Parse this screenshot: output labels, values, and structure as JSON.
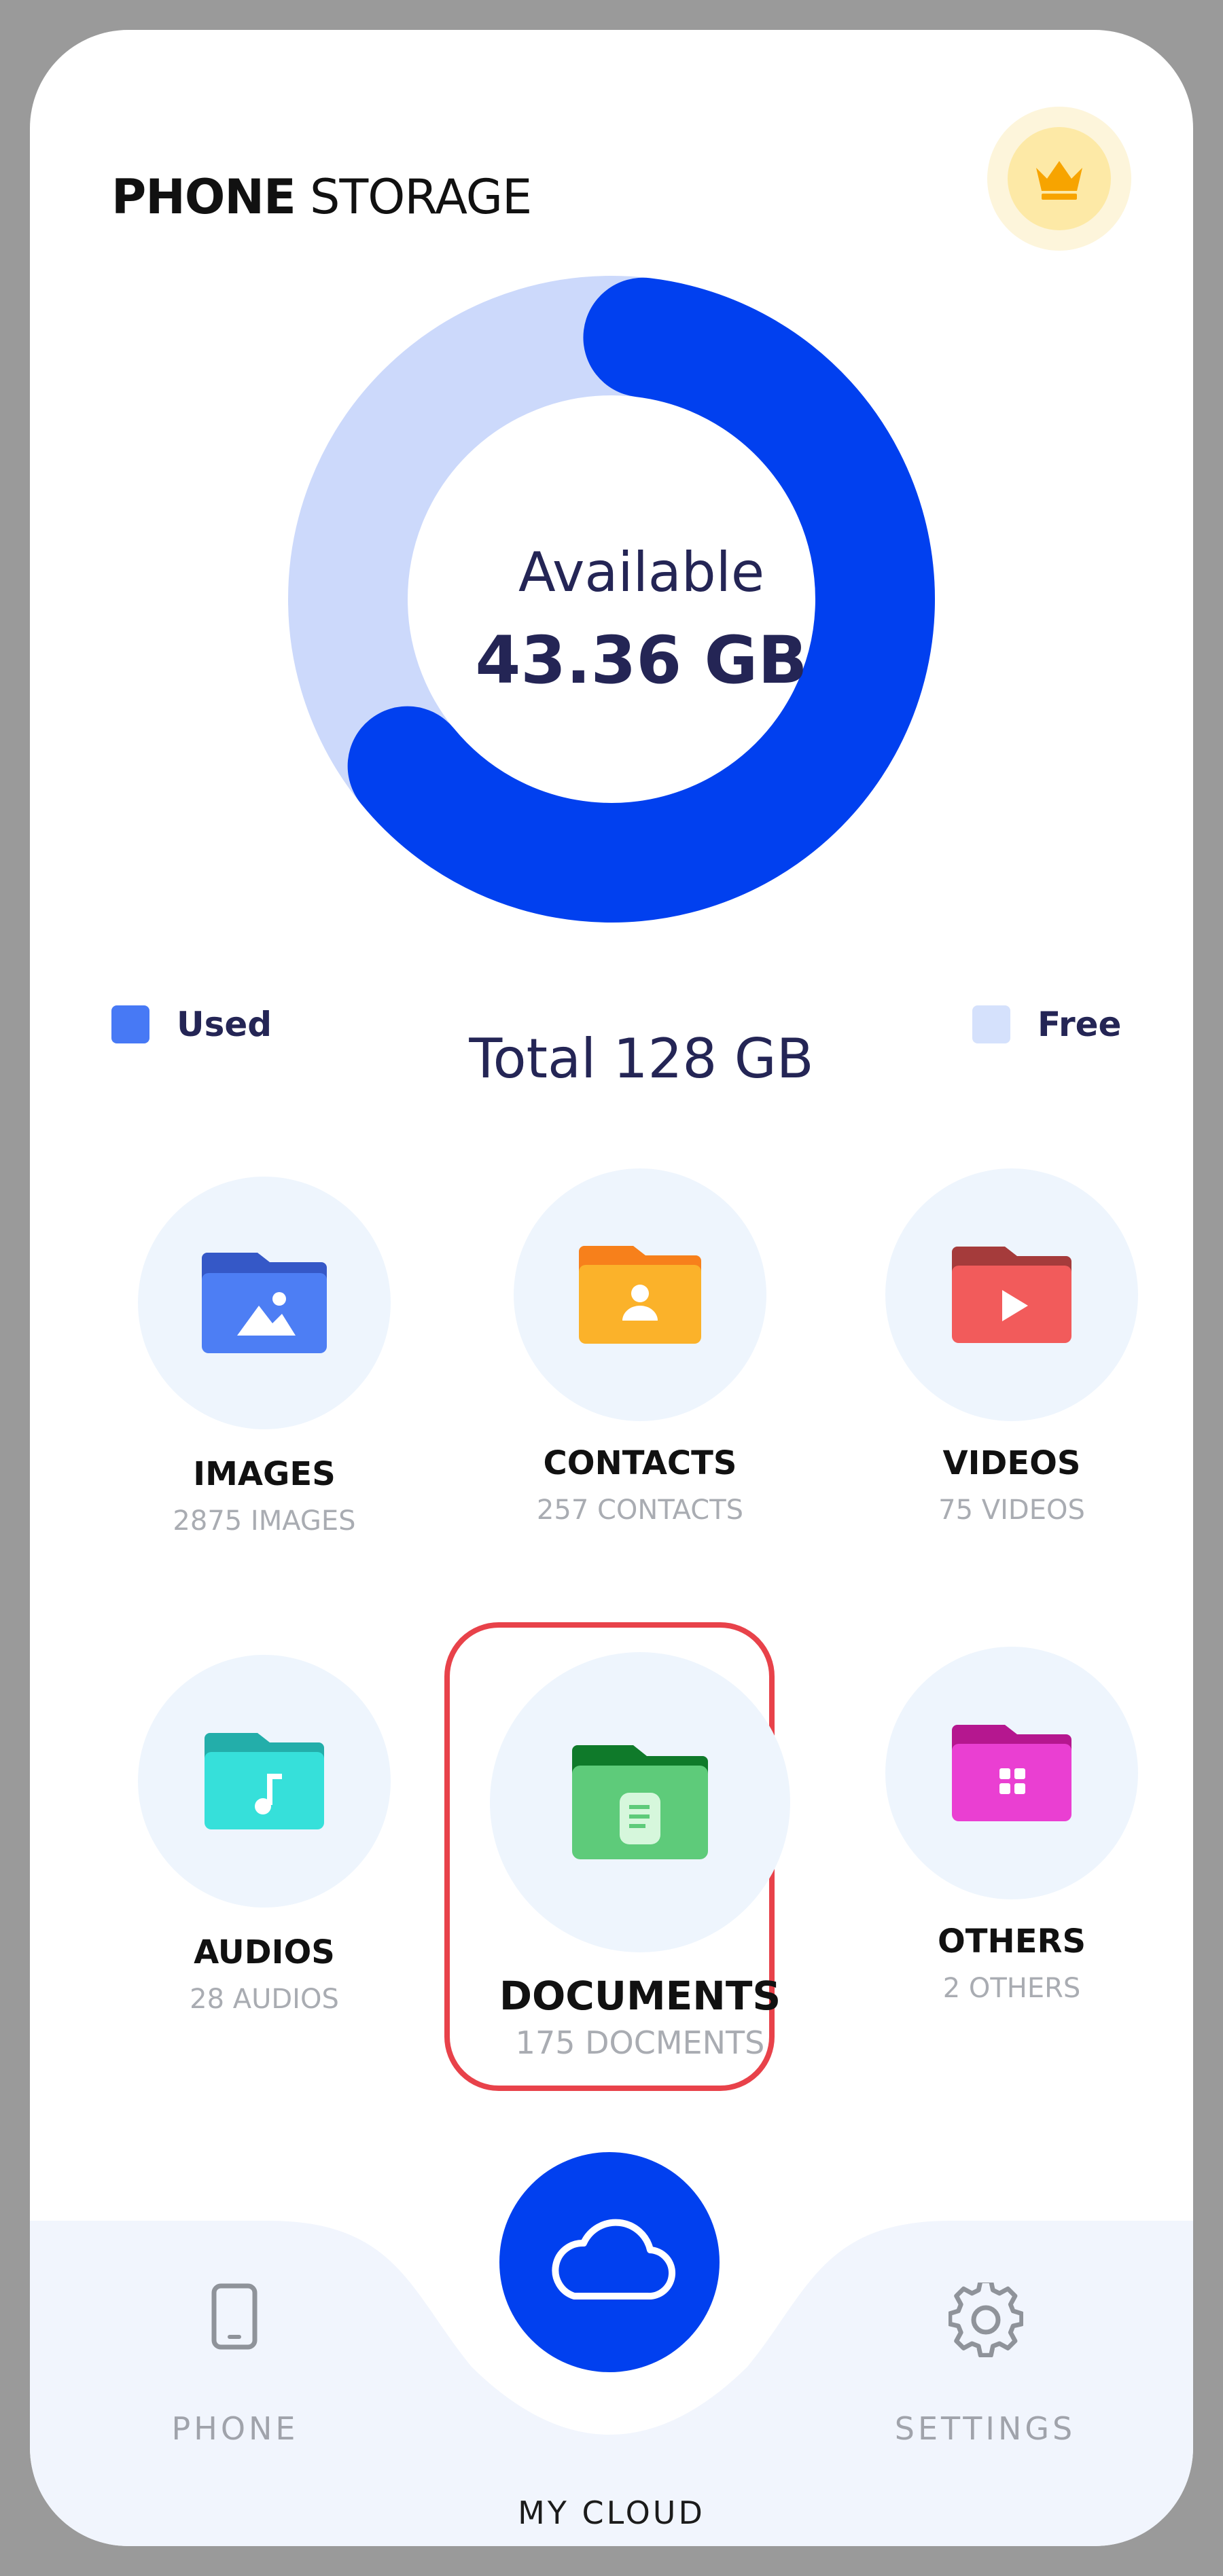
{
  "header": {
    "title_bold": "PHONE",
    "title_rest": " STORAGE",
    "premium_icon": "crown-icon"
  },
  "storage": {
    "available_label": "Available",
    "available_value": "43.36 GB",
    "total_label": "Total 128 GB",
    "used_fraction": 0.66,
    "legend": {
      "used_label": "Used",
      "free_label": "Free"
    },
    "colors": {
      "used": "#0140ef",
      "free": "#ccd9fb",
      "legend_used": "#4779f5",
      "legend_free": "#d5e1fc"
    }
  },
  "categories": [
    {
      "name": "IMAGES",
      "count": "2875 IMAGES",
      "icon": "image-folder-icon",
      "color": "#4d7ef4"
    },
    {
      "name": "CONTACTS",
      "count": "257 CONTACTS",
      "icon": "contact-folder-icon",
      "color": "#fbb22a"
    },
    {
      "name": "VIDEOS",
      "count": "75 VIDEOS",
      "icon": "video-folder-icon",
      "color": "#f25b5b"
    },
    {
      "name": "AUDIOS",
      "count": "28 AUDIOS",
      "icon": "audio-folder-icon",
      "color": "#36e0da"
    },
    {
      "name": "DOCUMENTS",
      "count": "175 DOCMENTS",
      "icon": "document-folder-icon",
      "color": "#5ecb7a"
    },
    {
      "name": "OTHERS",
      "count": "2 OTHERS",
      "icon": "others-folder-icon",
      "color": "#ea3fd2"
    }
  ],
  "bottom_nav": {
    "phone_label": "PHONE",
    "cloud_label": "MY CLOUD",
    "settings_label": "SETTINGS",
    "phone_icon": "phone-icon",
    "cloud_icon": "cloud-icon",
    "settings_icon": "gear-icon"
  }
}
